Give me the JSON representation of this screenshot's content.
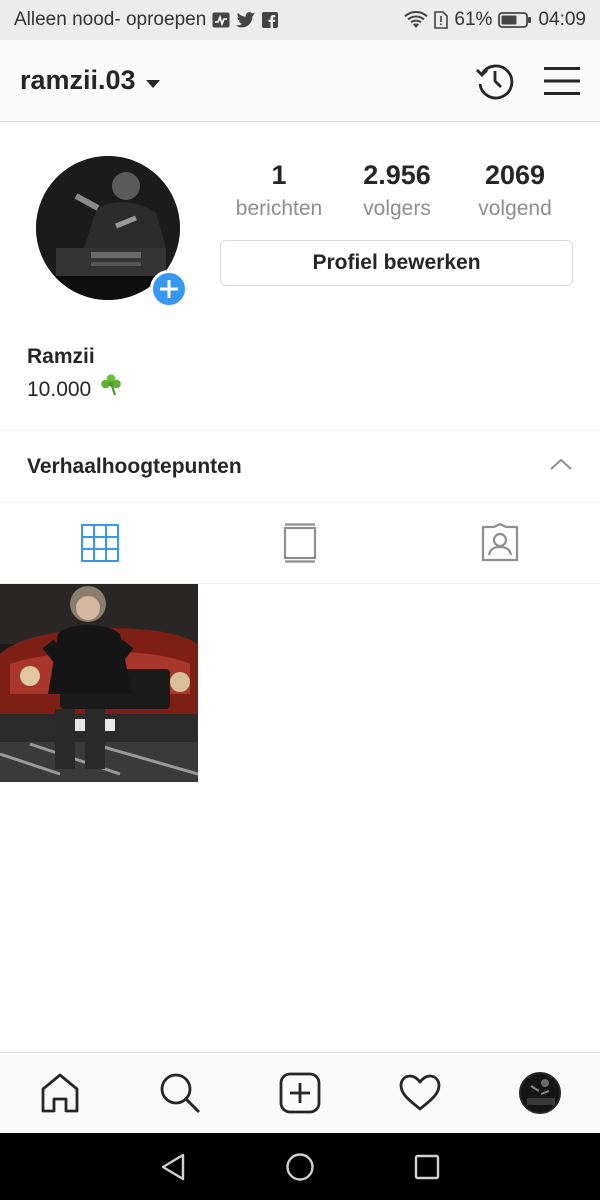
{
  "status_bar": {
    "carrier": "Alleen nood- oproepen",
    "battery": "61%",
    "time": "04:09"
  },
  "header": {
    "username": "ramzii.03"
  },
  "profile": {
    "stats": [
      {
        "value": "1",
        "label": "berichten"
      },
      {
        "value": "2.956",
        "label": "volgers"
      },
      {
        "value": "2069",
        "label": "volgend"
      }
    ],
    "edit_button": "Profiel bewerken",
    "name": "Ramzii",
    "bio": "10.000"
  },
  "highlights": {
    "title": "Verhaalhoogtepunten"
  },
  "tabs": [
    {
      "name": "grid",
      "icon": "grid-icon",
      "active": true
    },
    {
      "name": "igtv",
      "icon": "igtv-icon",
      "active": false
    },
    {
      "name": "tagged",
      "icon": "tagged-icon",
      "active": false
    }
  ],
  "colors": {
    "accent": "#3897f0",
    "text": "#262626",
    "muted": "#8e8e8e",
    "border": "#dbdbdb"
  }
}
